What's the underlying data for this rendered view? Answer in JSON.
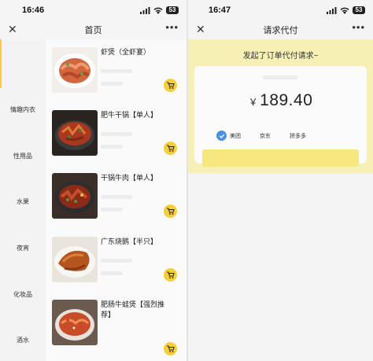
{
  "left_screen": {
    "status_time": "16:46",
    "battery": "53",
    "nav_title": "首页",
    "close_icon": "close-icon",
    "more_icon": "more-dots-icon",
    "categories": [
      {
        "label": ""
      },
      {
        "label": "情趣内衣"
      },
      {
        "label": "性用品"
      },
      {
        "label": "水果"
      },
      {
        "label": "夜宵"
      },
      {
        "label": "化妆品"
      },
      {
        "label": "酒水"
      }
    ],
    "dishes": [
      {
        "name": "虾煲（全虾宴）"
      },
      {
        "name": "肥牛干锅【单人】"
      },
      {
        "name": "干锅牛肉【单人】"
      },
      {
        "name": "广东烧鹅【半只】"
      },
      {
        "name": "肥肠牛蛙煲【强烈推荐】"
      }
    ],
    "cart_icon": "cart-icon"
  },
  "right_screen": {
    "status_time": "16:47",
    "battery": "53",
    "nav_title": "请求代付",
    "banner_text": "发起了订单代付请求~",
    "currency": "￥",
    "amount": "189.40",
    "platforms": [
      {
        "label": "美团",
        "selected": true
      },
      {
        "label": "京东",
        "selected": false
      },
      {
        "label": "拼多多",
        "selected": false
      }
    ],
    "accent_color": "#f5cf3b",
    "check_color": "#4a90e2"
  }
}
